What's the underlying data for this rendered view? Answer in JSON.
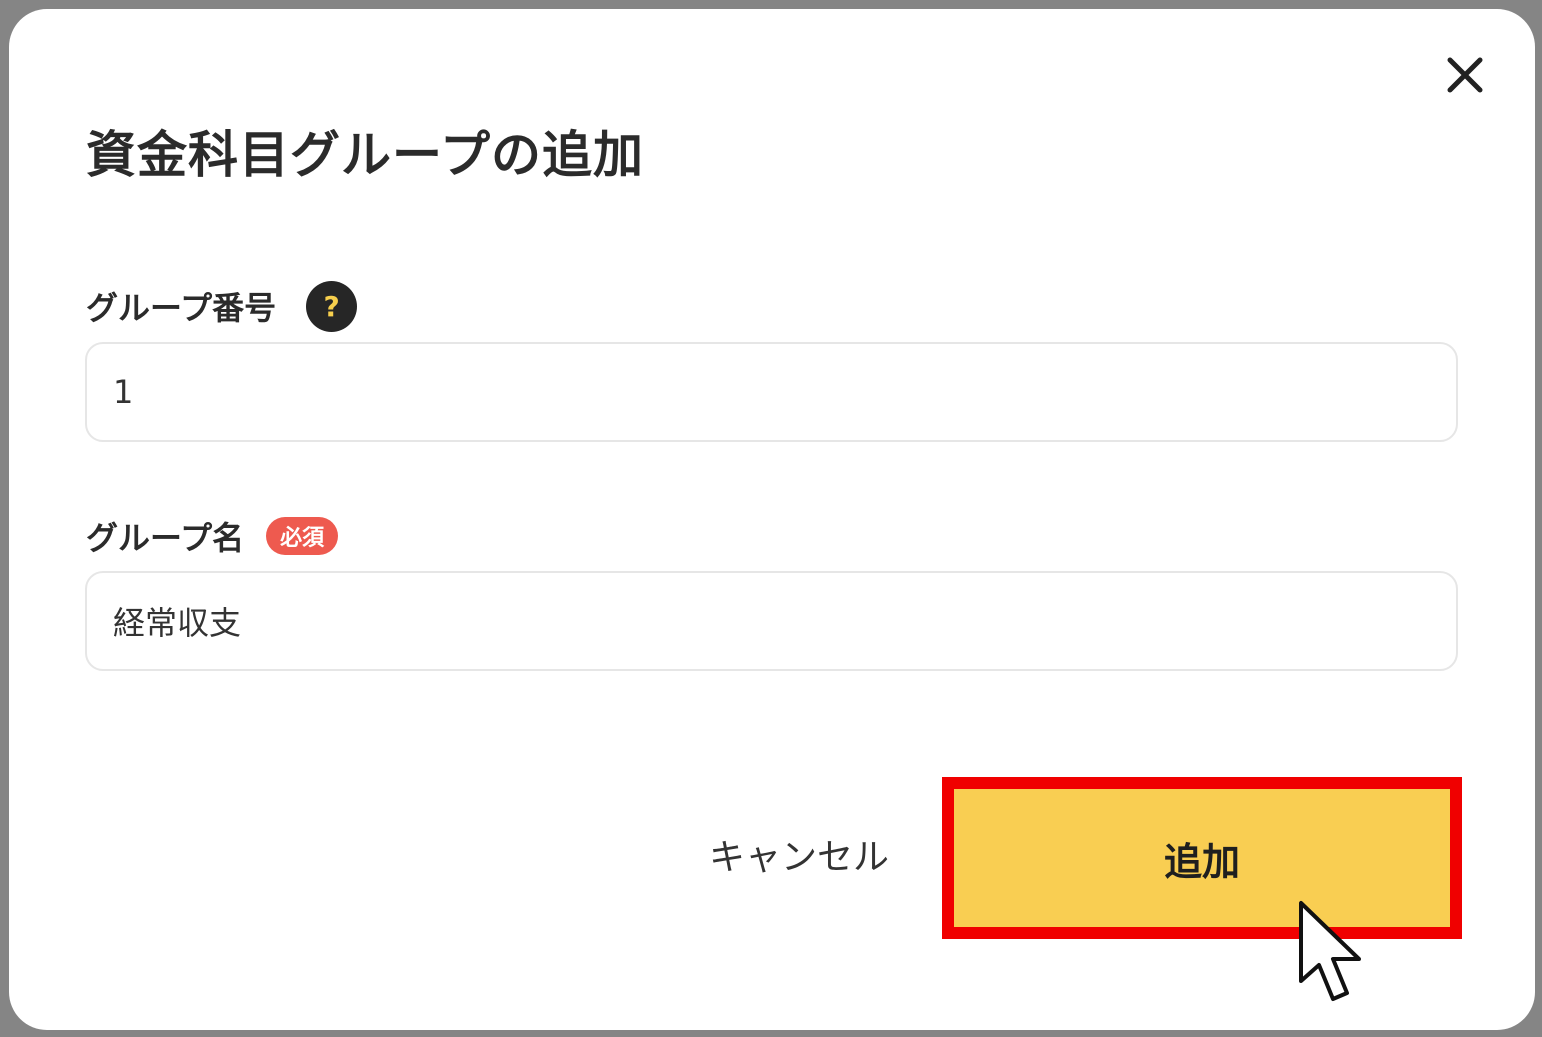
{
  "dialog": {
    "title": "資金科目グループの追加",
    "close_icon": "close-icon"
  },
  "fields": {
    "group_number": {
      "label": "グループ番号",
      "help_icon": "?",
      "value": "1"
    },
    "group_name": {
      "label": "グループ名",
      "required_badge": "必須",
      "value": "経常収支"
    }
  },
  "actions": {
    "cancel_label": "キャンセル",
    "add_label": "追加"
  },
  "colors": {
    "accent": "#f9ce52",
    "required": "#ee5a4f",
    "highlight": "#f00000",
    "help_icon_bg": "#262626"
  }
}
